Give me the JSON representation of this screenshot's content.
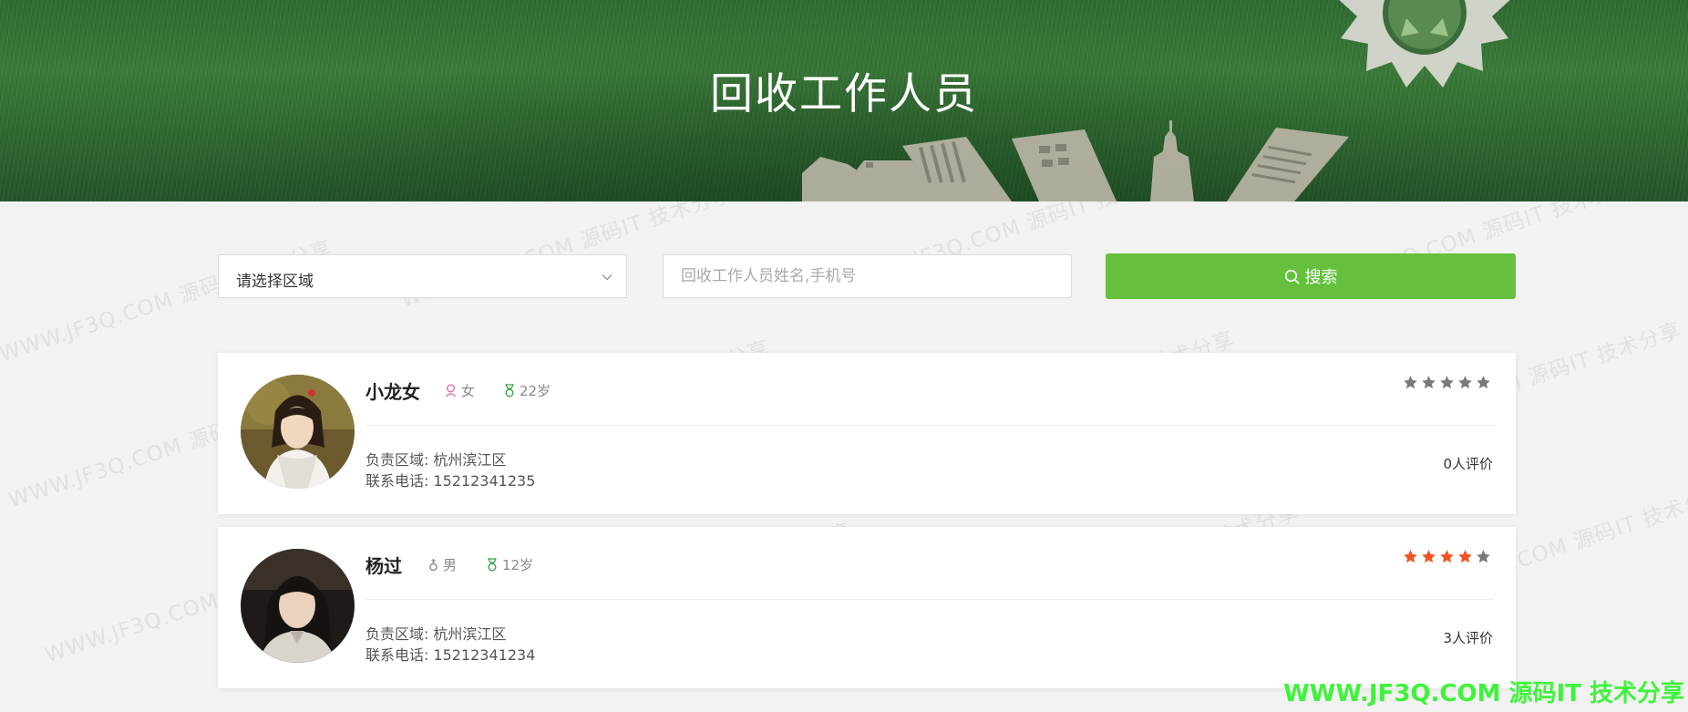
{
  "banner": {
    "title": "回收工作人员"
  },
  "search": {
    "region_placeholder": "请选择区域",
    "query_placeholder": "回收工作人员姓名,手机号",
    "button_label": "搜索"
  },
  "staff": [
    {
      "name": "小龙女",
      "gender": "女",
      "age": "22岁",
      "region_label": "负责区域:",
      "region": "杭州滨江区",
      "phone_label": "联系电话:",
      "phone": "15212341235",
      "rating": 0,
      "rating_max": 5,
      "reviews": "0人评价"
    },
    {
      "name": "杨过",
      "gender": "男",
      "age": "12岁",
      "region_label": "负责区域:",
      "region": "杭州滨江区",
      "phone_label": "联系电话:",
      "phone": "15212341234",
      "rating": 4,
      "rating_max": 5,
      "reviews": "3人评价"
    }
  ],
  "watermark": {
    "text": "WWW.JF3Q.COM 源码IT 技术分享",
    "corner": "WWW.JF3Q.COM 源码IT 技术分享"
  },
  "colors": {
    "accent": "#65c13d",
    "star_on": "#f2531f",
    "star_off": "#7a7a7a",
    "female": "#e36db0",
    "male": "#888888",
    "age_icon": "#2fa043"
  },
  "icons": {
    "search": "magnifier-icon",
    "dropdown": "chevron-down-icon",
    "female": "female-symbol-icon",
    "male": "male-symbol-icon",
    "age": "badge-icon",
    "rating": "star-icon"
  }
}
